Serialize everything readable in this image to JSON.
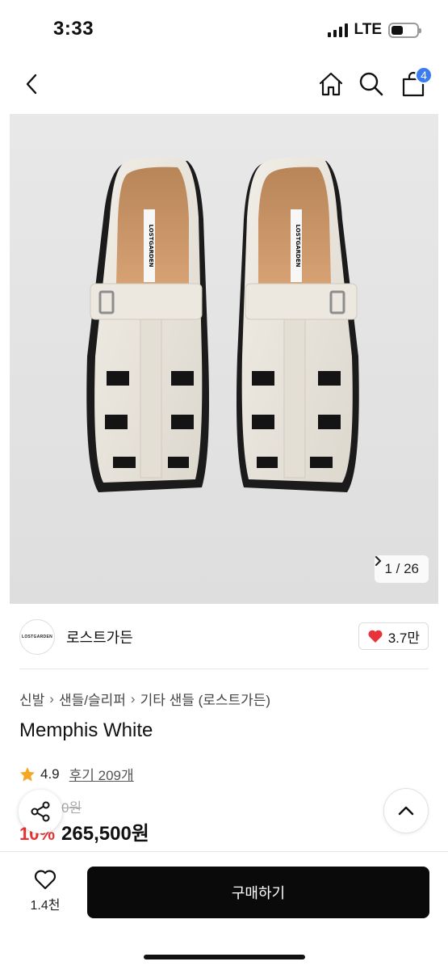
{
  "status_bar": {
    "time": "3:33",
    "network": "LTE"
  },
  "navbar": {
    "back_icon": "chevron-left-icon",
    "home_icon": "home-icon",
    "search_icon": "search-icon",
    "cart_icon": "cart-icon",
    "cart_badge": "4"
  },
  "gallery": {
    "current": "1 / 26",
    "shoe_label": "LOSTGARDEN"
  },
  "brand": {
    "logo_text": "LOSTGARDEN",
    "name": "로스트가든",
    "like_count": "3.7만"
  },
  "breadcrumb": [
    "신발",
    "샌들/슬리퍼",
    "기타 샌들 (로스트가든)"
  ],
  "product": {
    "title": "Memphis White",
    "rating": "4.9",
    "review_link": "후기 209개",
    "original_price": "295,000원",
    "discount": "10%",
    "sale_price": "265,500원"
  },
  "bottom_bar": {
    "wish_count": "1.4천",
    "buy_label": "구매하기"
  },
  "colors": {
    "accent_blue": "#3b7bf0",
    "discount_red": "#e63333",
    "buy_button": "#0a0a0a",
    "heart_red": "#e8333c",
    "star_orange": "#f5a623"
  }
}
